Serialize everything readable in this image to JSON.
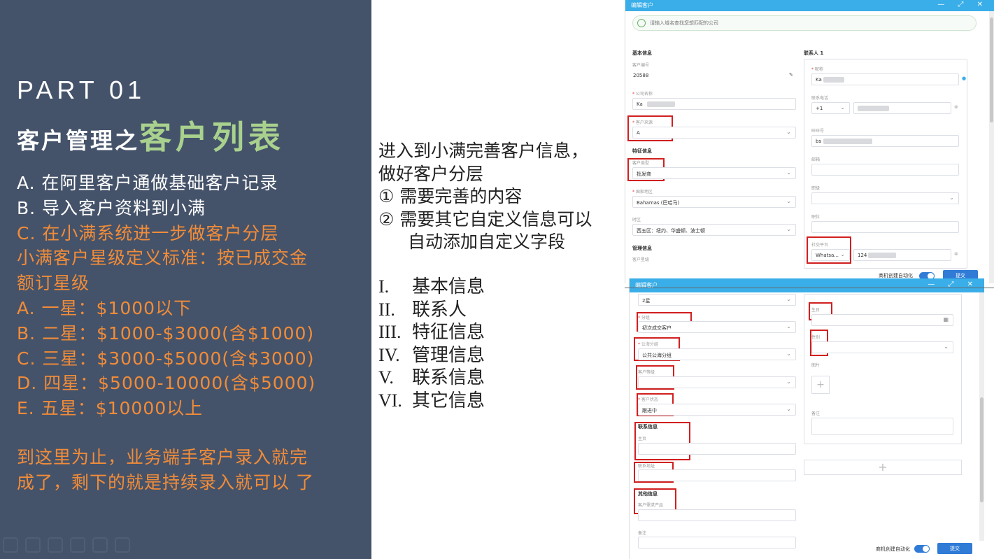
{
  "left": {
    "part": "PART 01",
    "title_prefix": "客户管理之",
    "title_highlight": "客户列表",
    "lines": [
      {
        "text": "A. 在阿里客户通做基础客户记录",
        "color": "#ffffff"
      },
      {
        "text": "B. 导入客户资料到小满",
        "color": "#ffffff"
      },
      {
        "text": "C. 在小满系统进一步做客户分层",
        "color": "#f28c38"
      },
      {
        "text": "小满客户星级定义标准：按已成交金",
        "color": "#f28c38"
      },
      {
        "text": "额订星级",
        "color": "#f28c38"
      },
      {
        "text": "A. 一星：$1000以下",
        "color": "#f28c38"
      },
      {
        "text": "B. 二星：$1000-$3000(含$1000)",
        "color": "#f28c38"
      },
      {
        "text": "C. 三星：$3000-$5000(含$3000)",
        "color": "#f28c38"
      },
      {
        "text": "D. 四星：$5000-10000(含$5000)",
        "color": "#f28c38"
      },
      {
        "text": "E. 五星：$10000以上",
        "color": "#f28c38"
      }
    ],
    "closing": [
      "到这里为止，业务端手客户录入就完",
      "成了，剩下的就是持续录入就可以 了"
    ]
  },
  "middle": {
    "intro": [
      "进入到小满完善客户信息，",
      "做好客户分层",
      "① 需要完善的内容",
      "② 需要其它自定义信息可以",
      "自动添加自定义字段"
    ],
    "list": [
      {
        "num": "I.",
        "text": "基本信息"
      },
      {
        "num": "II.",
        "text": "联系人"
      },
      {
        "num": "III.",
        "text": "特征信息"
      },
      {
        "num": "IV.",
        "text": "管理信息"
      },
      {
        "num": "V.",
        "text": "联系信息"
      },
      {
        "num": "VI.",
        "text": "其它信息"
      }
    ]
  },
  "shot1": {
    "title": "编辑客户",
    "controls": "— ⤢ ✕",
    "search_placeholder": "请输入域名查找您想匹配的公司",
    "basic_info": "基本信息",
    "customer_no_label": "客户编号",
    "customer_no": "20588",
    "company_label": "公司名称",
    "company_value": "Ka",
    "source_label": "客户来源",
    "source_value": "A",
    "feature_info": "特征信息",
    "type_label": "客户类型",
    "type_value": "批发商",
    "country_label": "国家地区",
    "country_value": "Bahamas (巴哈马)",
    "timezone_label": "时区",
    "timezone_value": "西五区：纽约、华盛顿、波士顿",
    "manage_info": "管理信息",
    "star_label": "客户星级",
    "contact_header": "联系人 1",
    "nickname_label": "昵称",
    "nickname_value": "Ka",
    "phone_label": "联系电话",
    "phone_code": "+1",
    "wangwang_label": "旺旺号",
    "wangwang_value": "bs",
    "email_label": "邮箱",
    "gender_label": "职级",
    "position_label": "职位",
    "social_label": "社交平台",
    "social_value": "Whatsa...",
    "social_num": "124",
    "auto_label": "商机创建自动化",
    "submit": "提交"
  },
  "shot2": {
    "title": "编辑客户",
    "controls": "— ⤢ ✕",
    "star_value": "2星",
    "group_label": "分组",
    "group_value": "初次成交客户",
    "pool_label": "公海分组",
    "pool_value": "公共公海分组",
    "level_label": "客户等级",
    "status_label": "客户状态",
    "status_value": "跟进中",
    "contact_info": "联系信息",
    "homepage_label": "主页",
    "address_label": "联系地址",
    "other_info": "其他信息",
    "product_label": "客户需求产品",
    "remark_label": "备注",
    "birthday_label": "生日",
    "sex_label": "性别",
    "image_label": "图片",
    "note_label": "备注",
    "auto_label": "商机创建自动化",
    "submit": "提交"
  },
  "colors": {
    "accent_green": "#a9d18e",
    "accent_orange": "#f28c38",
    "panel_bg": "#45536a",
    "window_blue": "#3aaee8",
    "highlight_red": "#d11f1f"
  }
}
